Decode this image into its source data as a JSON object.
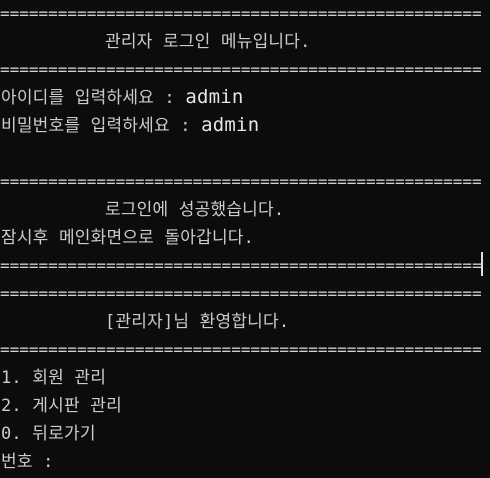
{
  "terminal": {
    "separator": "========================================================",
    "menu_title": "관리자 로그인 메뉴입니다.",
    "id_prompt": "아이디를 입력하세요 : ",
    "id_value": "admin",
    "pw_prompt": "비밀번호를 입력하세요 : ",
    "pw_value": "admin",
    "login_success": "로그인에 성공했습니다.",
    "redirect_msg": "잠시후 메인화면으로 돌아갑니다.",
    "welcome": "[관리자]님 환영합니다.",
    "menu_items": [
      "1. 회원 관리",
      "2. 게시판 관리",
      "0. 뒤로가기"
    ],
    "number_prompt": "번호 : "
  }
}
